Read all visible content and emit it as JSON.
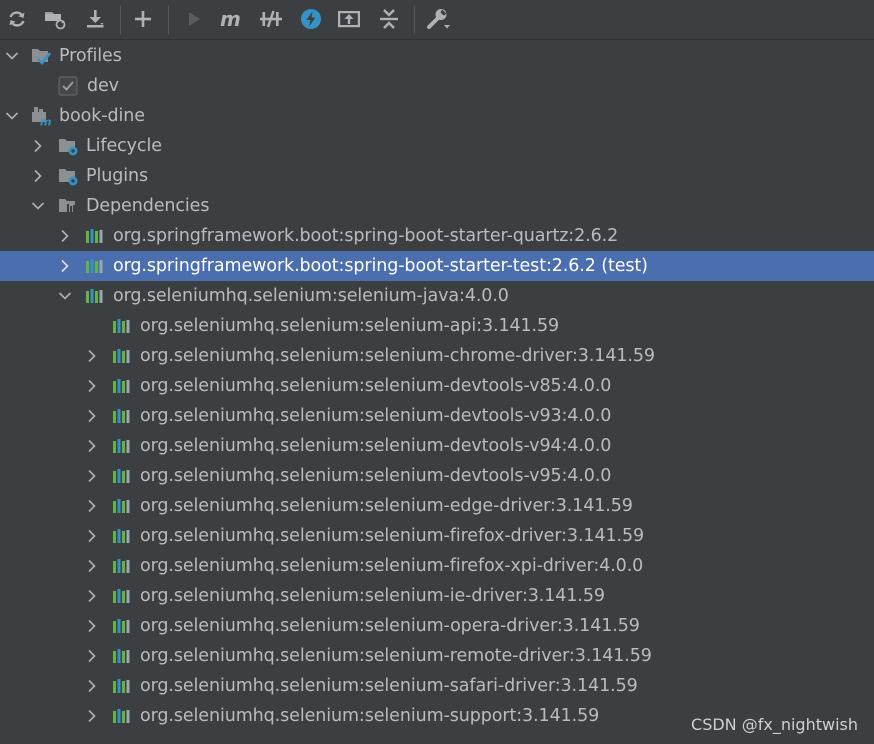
{
  "toolbar": {
    "buttons": [
      {
        "name": "reload-icon"
      },
      {
        "name": "generate-sources-icon"
      },
      {
        "name": "download-icon"
      },
      {
        "name": "add-icon"
      },
      {
        "name": "run-icon"
      },
      {
        "name": "execute-goal-icon"
      },
      {
        "name": "toggle-offline-icon"
      },
      {
        "name": "skip-tests-icon"
      },
      {
        "name": "show-dependencies-icon"
      },
      {
        "name": "collapse-all-icon"
      },
      {
        "name": "settings-icon"
      }
    ]
  },
  "colors": {
    "background": "#3c3f41",
    "selection": "#4b6eaf",
    "text": "#bbbbbb",
    "accent_blue": "#3592c4",
    "lib_green": "#62b543"
  },
  "tree": {
    "profiles": {
      "label": "Profiles",
      "expanded": true
    },
    "dev_profile": {
      "label": "dev",
      "checked": true
    },
    "project": {
      "label": "book-dine",
      "expanded": true
    },
    "lifecycle": {
      "label": "Lifecycle",
      "expanded": false
    },
    "plugins": {
      "label": "Plugins",
      "expanded": false
    },
    "dependencies": {
      "label": "Dependencies",
      "expanded": true
    },
    "dep_quartz": {
      "label": "org.springframework.boot:spring-boot-starter-quartz:2.6.2"
    },
    "dep_test": {
      "label": "org.springframework.boot:spring-boot-starter-test:2.6.2 (test)",
      "selected": true
    },
    "dep_selenium_java": {
      "label": "org.seleniumhq.selenium:selenium-java:4.0.0",
      "expanded": true
    },
    "selenium_children": [
      {
        "label": "org.seleniumhq.selenium:selenium-api:3.141.59",
        "has_children": false
      },
      {
        "label": "org.seleniumhq.selenium:selenium-chrome-driver:3.141.59",
        "has_children": true
      },
      {
        "label": "org.seleniumhq.selenium:selenium-devtools-v85:4.0.0",
        "has_children": true
      },
      {
        "label": "org.seleniumhq.selenium:selenium-devtools-v93:4.0.0",
        "has_children": true
      },
      {
        "label": "org.seleniumhq.selenium:selenium-devtools-v94:4.0.0",
        "has_children": true
      },
      {
        "label": "org.seleniumhq.selenium:selenium-devtools-v95:4.0.0",
        "has_children": true
      },
      {
        "label": "org.seleniumhq.selenium:selenium-edge-driver:3.141.59",
        "has_children": true
      },
      {
        "label": "org.seleniumhq.selenium:selenium-firefox-driver:3.141.59",
        "has_children": true
      },
      {
        "label": "org.seleniumhq.selenium:selenium-firefox-xpi-driver:4.0.0",
        "has_children": true
      },
      {
        "label": "org.seleniumhq.selenium:selenium-ie-driver:3.141.59",
        "has_children": true
      },
      {
        "label": "org.seleniumhq.selenium:selenium-opera-driver:3.141.59",
        "has_children": true
      },
      {
        "label": "org.seleniumhq.selenium:selenium-remote-driver:3.141.59",
        "has_children": true
      },
      {
        "label": "org.seleniumhq.selenium:selenium-safari-driver:3.141.59",
        "has_children": true
      },
      {
        "label": "org.seleniumhq.selenium:selenium-support:3.141.59",
        "has_children": true
      }
    ]
  },
  "watermark": {
    "text": "CSDN @fx_nightwish"
  }
}
